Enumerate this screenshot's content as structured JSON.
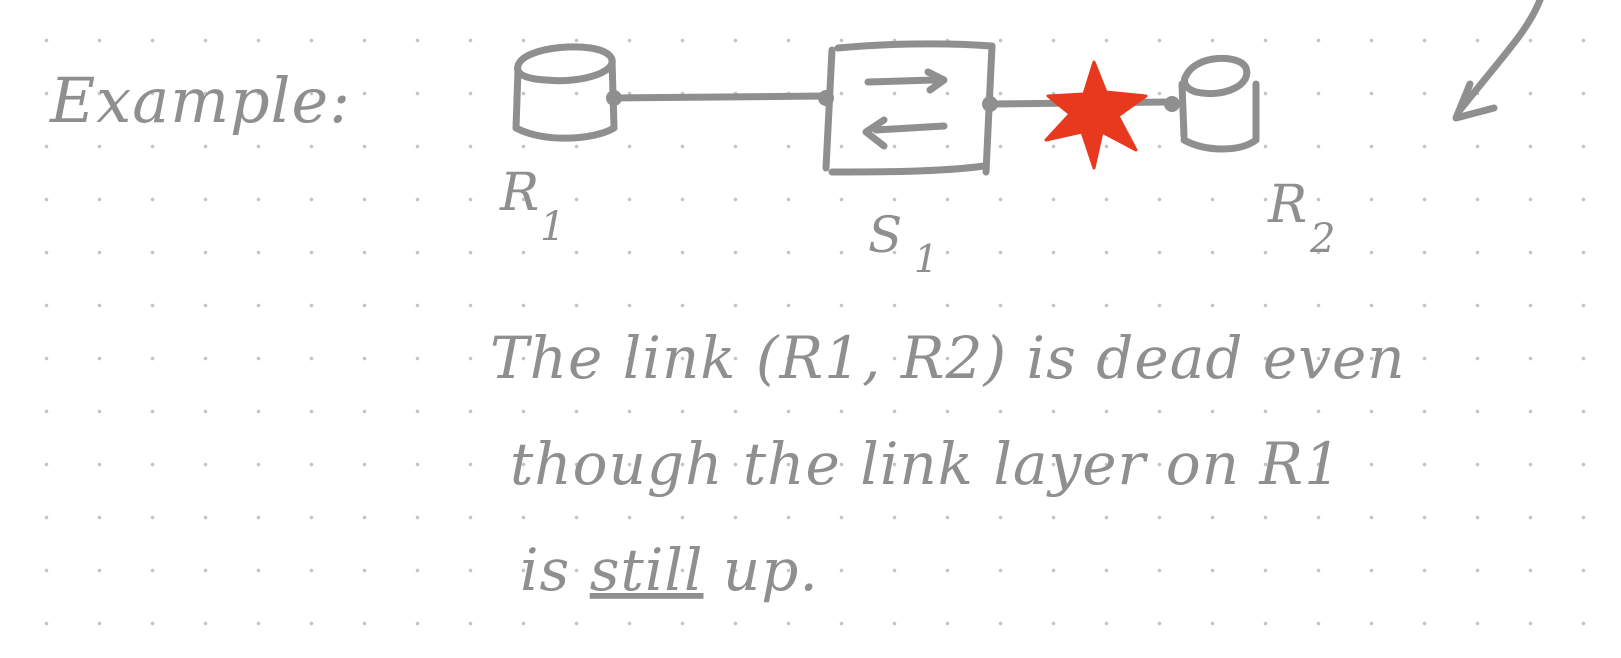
{
  "colors": {
    "ink": "#8f8f8f",
    "failure": "#e8391e",
    "background": "#ffffff",
    "grid_dot": "#c4c4c4"
  },
  "heading": "Example:",
  "nodes": {
    "r1": {
      "label": "R",
      "subscript": "1",
      "shape": "router-cylinder"
    },
    "s1": {
      "label": "S",
      "subscript": "1",
      "shape": "switch-box"
    },
    "r2": {
      "label": "R",
      "subscript": "2",
      "shape": "router-cylinder"
    }
  },
  "failure_marker": "red-star-icon",
  "note": {
    "line1": "The link (R1, R2) is dead even",
    "line2": "though the link layer on R1",
    "line3_prefix": "is ",
    "line3_underlined": "still",
    "line3_suffix": " up."
  }
}
